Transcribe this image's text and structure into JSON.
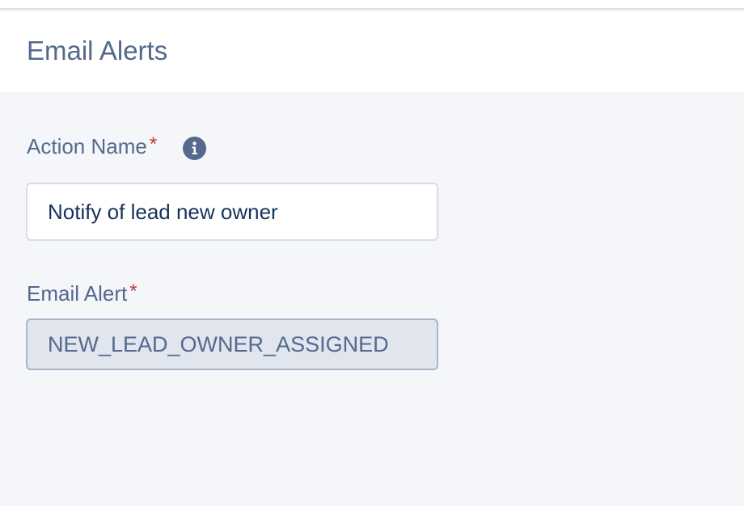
{
  "header": {
    "title": "Email Alerts"
  },
  "form": {
    "action_name": {
      "label": "Action Name",
      "required_marker": "*",
      "info_icon": "info-icon",
      "value": "Notify of lead new owner"
    },
    "email_alert": {
      "label": "Email Alert",
      "required_marker": "*",
      "value": "NEW_LEAD_OWNER_ASSIGNED"
    }
  },
  "colors": {
    "label_text": "#54698d",
    "required": "#c23934",
    "input_text": "#16325c",
    "background": "#f4f6f9"
  }
}
